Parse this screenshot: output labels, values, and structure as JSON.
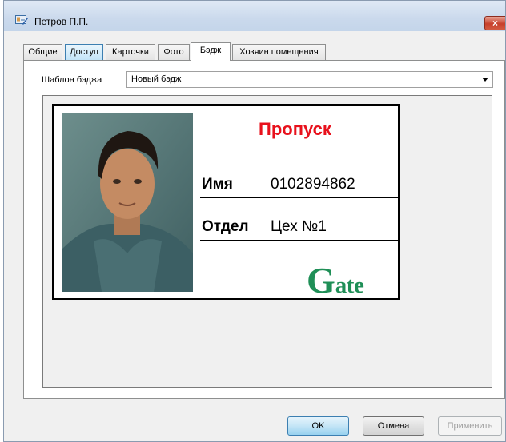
{
  "window": {
    "title": "Петров П.П.",
    "close_label": "×"
  },
  "tabs": [
    {
      "label": "Общие",
      "state": "normal"
    },
    {
      "label": "Доступ",
      "state": "hover"
    },
    {
      "label": "Карточки",
      "state": "normal"
    },
    {
      "label": "Фото",
      "state": "normal"
    },
    {
      "label": "Бэдж",
      "state": "active"
    },
    {
      "label": "Хозяин помещения",
      "state": "normal"
    }
  ],
  "badge_template": {
    "label": "Шаблон бэджа",
    "value": "Новый бэдж"
  },
  "badge": {
    "title": "Пропуск",
    "name_label": "Имя",
    "name_value": "0102894862",
    "dept_label": "Отдел",
    "dept_value": "Цех №1",
    "logo_initial": "G",
    "logo_rest": "ate"
  },
  "buttons": {
    "ok": "OK",
    "cancel": "Отмена",
    "apply": "Применить"
  },
  "colors": {
    "badge_title": "#e8111c",
    "logo": "#1f8f57"
  }
}
